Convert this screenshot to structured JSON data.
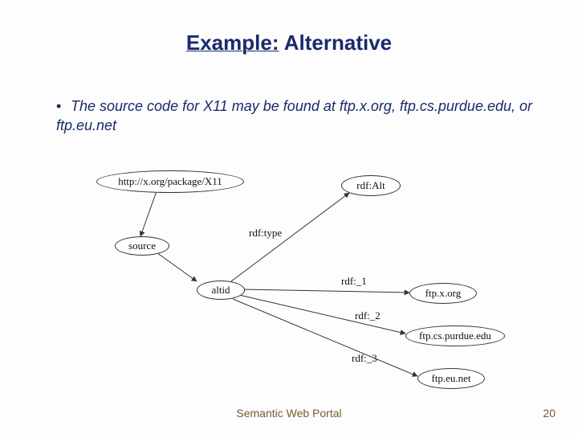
{
  "title_prefix": "Example:",
  "title_rest": " Alternative",
  "bullet": "The source code for X11 may be found at ftp.x.org, ftp.cs.purdue.edu, or ftp.eu.net",
  "nodes": {
    "subject": "http://x.org/package/X11",
    "source": "source",
    "altid": "altid",
    "rdfAlt": "rdf:Alt",
    "ftp1": "ftp.x.org",
    "ftp2": "ftp.cs.purdue.edu",
    "ftp3": "ftp.eu.net"
  },
  "edges": {
    "type": "rdf:type",
    "r1": "rdf:_1",
    "r2": "rdf:_2",
    "r3": "rdf:_3"
  },
  "footer": "Semantic Web Portal",
  "page": "20"
}
